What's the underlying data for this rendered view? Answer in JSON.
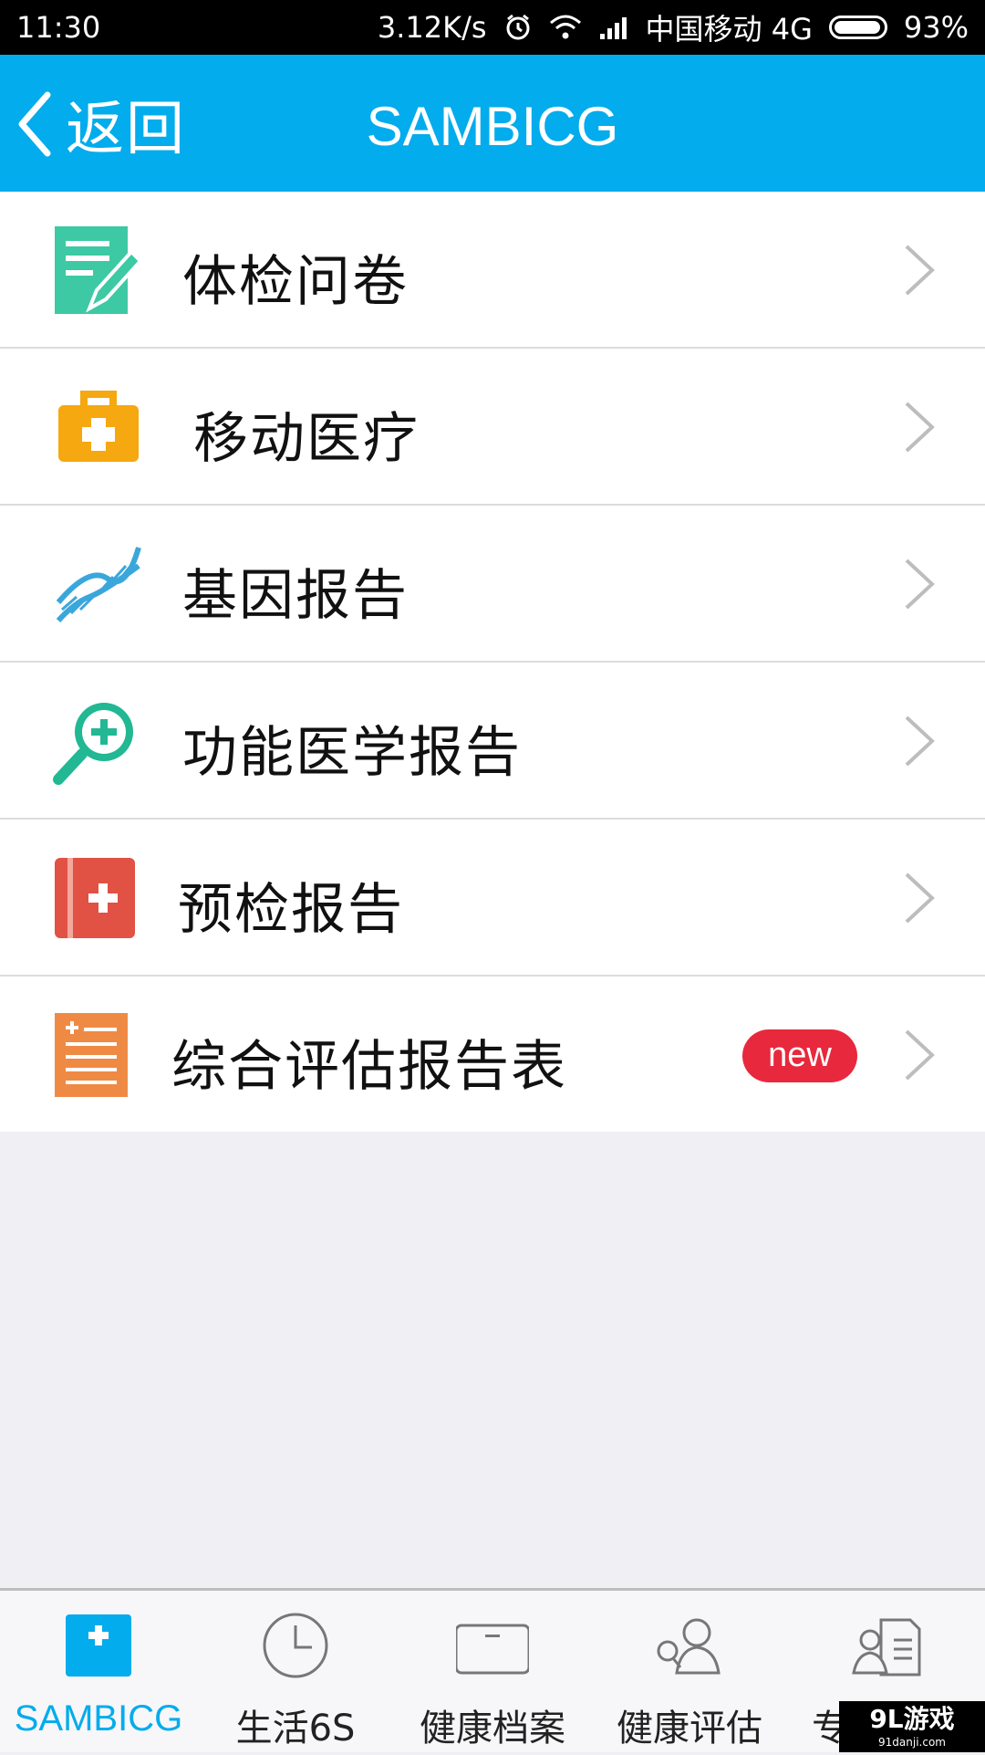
{
  "status_bar": {
    "time": "11:30",
    "net_speed": "3.12K/s",
    "carrier": "中国移动 4G",
    "battery": "93%",
    "icons": [
      "alarm-icon",
      "wifi-icon",
      "signal-icon",
      "battery-icon"
    ]
  },
  "header": {
    "back_label": "返回",
    "title": "SAMBICG"
  },
  "menu": {
    "items": [
      {
        "label": "体检问卷",
        "icon": "questionnaire-icon"
      },
      {
        "label": "移动医疗",
        "icon": "medical-kit-icon"
      },
      {
        "label": "基因报告",
        "icon": "dna-icon"
      },
      {
        "label": "功能医学报告",
        "icon": "magnifier-plus-icon"
      },
      {
        "label": "预检报告",
        "icon": "medical-book-icon"
      },
      {
        "label": "综合评估报告表",
        "icon": "report-sheet-icon",
        "badge": "new"
      }
    ]
  },
  "tabbar": {
    "tabs": [
      {
        "label": "SAMBICG",
        "icon": "medical-cross-icon",
        "active": true
      },
      {
        "label": "生活6S",
        "icon": "clock-icon"
      },
      {
        "label": "健康档案",
        "icon": "folder-icon"
      },
      {
        "label": "健康评估",
        "icon": "user-search-icon"
      },
      {
        "label": "专",
        "icon": "user-document-icon"
      }
    ]
  },
  "watermark": {
    "brand": "9L游戏",
    "url": "91danji.com"
  },
  "colors": {
    "accent": "#03acec",
    "badge": "#e8283c"
  }
}
